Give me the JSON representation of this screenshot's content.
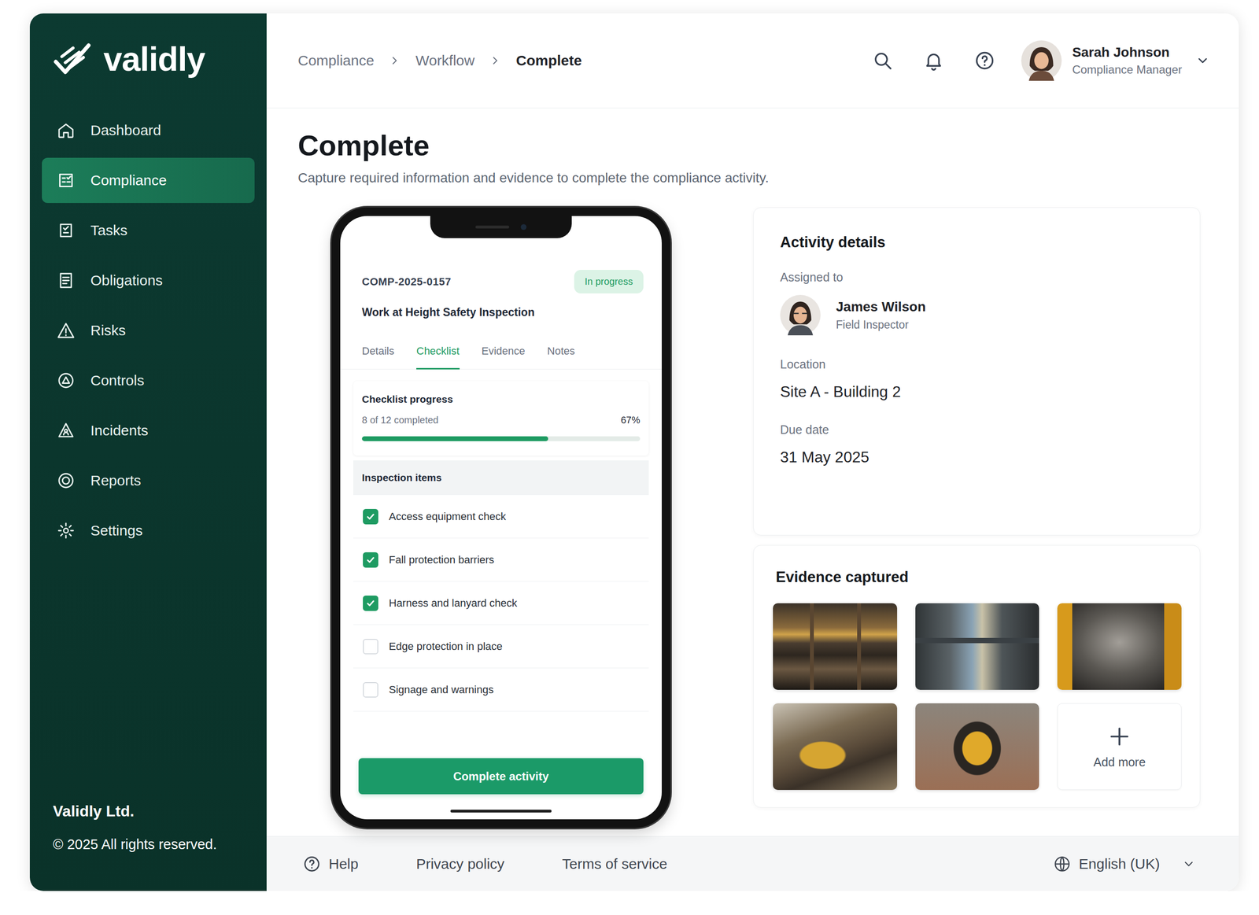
{
  "logo": {
    "text": "validly"
  },
  "sidebar": {
    "items": [
      {
        "label": "Dashboard",
        "selected": false
      },
      {
        "label": "Compliance",
        "selected": true
      },
      {
        "label": "Tasks",
        "selected": false
      },
      {
        "label": "Obligations",
        "selected": false
      },
      {
        "label": "Risks",
        "selected": false
      },
      {
        "label": "Controls",
        "selected": false
      },
      {
        "label": "Incidents",
        "selected": false
      },
      {
        "label": "Reports",
        "selected": false
      },
      {
        "label": "Settings",
        "selected": false
      }
    ],
    "company": "Validly Ltd.",
    "copyright": "© 2025 All rights reserved."
  },
  "breadcrumbs": [
    {
      "label": "Compliance",
      "current": false
    },
    {
      "label": "Workflow",
      "current": false
    },
    {
      "label": "Complete",
      "current": true
    }
  ],
  "user": {
    "name": "Sarah Johnson",
    "role": "Compliance Manager"
  },
  "page": {
    "title": "Complete",
    "subtitle": "Capture required information and evidence to complete the compliance activity."
  },
  "phone": {
    "id": "COMP-2025-0157",
    "status": "In progress",
    "title": "Work at Height Safety Inspection",
    "tabs": [
      {
        "label": "Details",
        "selected": false
      },
      {
        "label": "Checklist",
        "selected": true
      },
      {
        "label": "Evidence",
        "selected": false
      },
      {
        "label": "Notes",
        "selected": false
      }
    ],
    "progress": {
      "title": "Checklist progress",
      "reading": "8 of 12 completed",
      "percent": "67%",
      "level": 0.67
    },
    "items_title": "Inspection items",
    "items": [
      {
        "label": "Access equipment check",
        "checked": true
      },
      {
        "label": "Fall protection barriers",
        "checked": true
      },
      {
        "label": "Harness and lanyard check",
        "checked": true
      },
      {
        "label": "Edge protection in place",
        "checked": false
      },
      {
        "label": "Signage and warnings",
        "checked": false
      }
    ],
    "button": "Complete activity"
  },
  "activity": {
    "title": "Activity details",
    "assigned_label": "Assigned to",
    "assignee": {
      "name": "James Wilson",
      "role": "Field Inspector"
    },
    "fields": [
      {
        "label": "Location",
        "value": "Site A - Building 2"
      },
      {
        "label": "Due date",
        "value": "31 May 2025"
      }
    ]
  },
  "evidence": {
    "title": "Evidence captured",
    "tiles": [
      {
        "kind": "photo"
      },
      {
        "kind": "photo"
      },
      {
        "kind": "photo"
      },
      {
        "kind": "photo"
      },
      {
        "kind": "photo"
      },
      {
        "kind": "add",
        "label": "Add more"
      }
    ]
  },
  "footer": {
    "links": [
      {
        "label": "Help",
        "kind": "help"
      },
      {
        "label": "Privacy policy",
        "kind": "link"
      },
      {
        "label": "Terms of service",
        "kind": "link"
      }
    ],
    "language": "English (UK)"
  }
}
